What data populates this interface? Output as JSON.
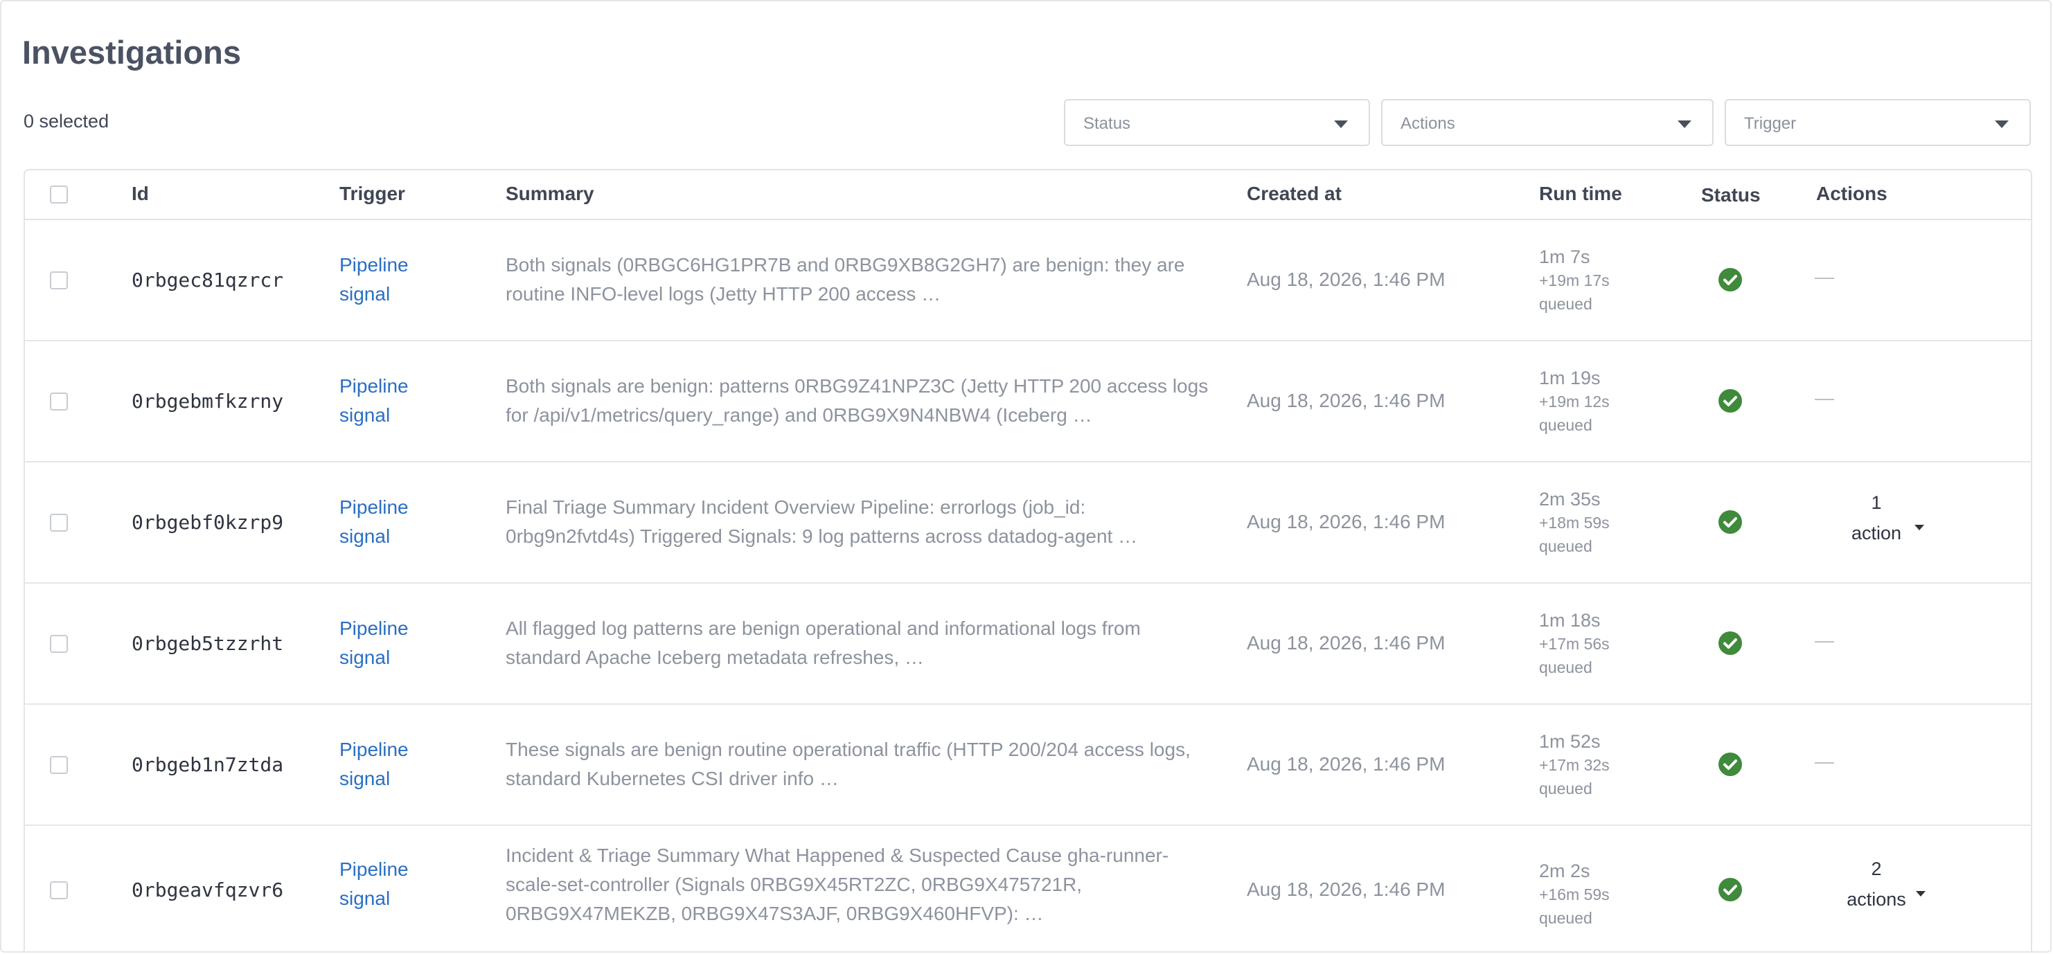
{
  "page": {
    "title": "Investigations",
    "selected_text": "0 selected"
  },
  "filters": {
    "status": "Status",
    "actions": "Actions",
    "trigger": "Trigger"
  },
  "table": {
    "columns": {
      "id": "Id",
      "trigger": "Trigger",
      "summary": "Summary",
      "created_at": "Created at",
      "run_time": "Run time",
      "status": "Status",
      "actions": "Actions"
    },
    "rows": [
      {
        "id": "0rbgec81qzrcr",
        "trigger": "Pipeline signal",
        "summary": "Both signals (0RBGC6HG1PR7B and 0RBG9XB8G2GH7) are benign: they are routine INFO-level logs (Jetty HTTP 200 access …",
        "created_at": "Aug 18, 2026, 1:46 PM",
        "run_time": "1m 7s",
        "queued_delay": "+19m 17s",
        "queued_label": "queued",
        "status": "check-circle-icon",
        "actions_count": "",
        "actions_label": "",
        "actions_dash": "—"
      },
      {
        "id": "0rbgebmfkzrny",
        "trigger": "Pipeline signal",
        "summary": "Both signals are benign: patterns 0RBG9Z41NPZ3C (Jetty HTTP 200 access logs for /api/v1/metrics/query_range) and 0RBG9X9N4NBW4 (Iceberg …",
        "created_at": "Aug 18, 2026, 1:46 PM",
        "run_time": "1m 19s",
        "queued_delay": "+19m 12s",
        "queued_label": "queued",
        "status": "check-circle-icon",
        "actions_count": "",
        "actions_label": "",
        "actions_dash": "—"
      },
      {
        "id": "0rbgebf0kzrp9",
        "trigger": "Pipeline signal",
        "summary": "Final Triage Summary Incident Overview Pipeline: errorlogs (job_id: 0rbg9n2fvtd4s) Triggered Signals: 9 log patterns across datadog-agent …",
        "created_at": "Aug 18, 2026, 1:46 PM",
        "run_time": "2m 35s",
        "queued_delay": "+18m 59s",
        "queued_label": "queued",
        "status": "check-circle-icon",
        "actions_count": "1",
        "actions_label": "action",
        "actions_dash": ""
      },
      {
        "id": "0rbgeb5tzzrht",
        "trigger": "Pipeline signal",
        "summary": "All flagged log patterns are benign operational and informational logs from standard Apache Iceberg metadata refreshes, …",
        "created_at": "Aug 18, 2026, 1:46 PM",
        "run_time": "1m 18s",
        "queued_delay": "+17m 56s",
        "queued_label": "queued",
        "status": "check-circle-icon",
        "actions_count": "",
        "actions_label": "",
        "actions_dash": "—"
      },
      {
        "id": "0rbgeb1n7ztda",
        "trigger": "Pipeline signal",
        "summary": "These signals are benign routine operational traffic (HTTP 200/204 access logs, standard Kubernetes CSI driver info …",
        "created_at": "Aug 18, 2026, 1:46 PM",
        "run_time": "1m 52s",
        "queued_delay": "+17m 32s",
        "queued_label": "queued",
        "status": "check-circle-icon",
        "actions_count": "",
        "actions_label": "",
        "actions_dash": "—"
      },
      {
        "id": "0rbgeavfqzvr6",
        "trigger": "Pipeline signal",
        "summary": "Incident & Triage Summary What Happened & Suspected Cause gha-runner-scale-set-controller (Signals 0RBG9X45RT2ZC, 0RBG9X475721R, 0RBG9X47MEKZB, 0RBG9X47S3AJF, 0RBG9X460HFVP): …",
        "created_at": "Aug 18, 2026, 1:46 PM",
        "run_time": "2m 2s",
        "queued_delay": "+16m 59s",
        "queued_label": "queued",
        "status": "check-circle-icon",
        "actions_count": "2",
        "actions_label": "actions",
        "actions_dash": ""
      }
    ]
  },
  "colors": {
    "link": "#2a6fc4",
    "success": "#3f8a3b",
    "muted_text": "#8d939e",
    "border": "#e1e4e9"
  }
}
